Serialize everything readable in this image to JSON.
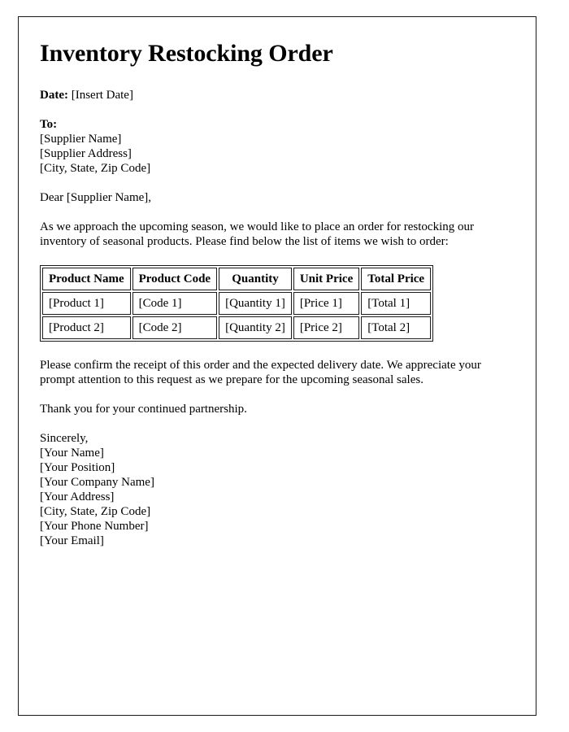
{
  "document": {
    "title": "Inventory Restocking Order",
    "date_label": "Date:",
    "date_value": "[Insert Date]",
    "to_label": "To:",
    "recipient_lines": [
      "[Supplier Name]",
      "[Supplier Address]",
      "[City, State, Zip Code]"
    ],
    "salutation": "Dear [Supplier Name],",
    "intro_paragraph": "As we approach the upcoming season, we would like to place an order for restocking our inventory of seasonal products. Please find below the list of items we wish to order:",
    "confirm_paragraph": "Please confirm the receipt of this order and the expected delivery date. We appreciate your prompt attention to this request as we prepare for the upcoming seasonal sales.",
    "thanks_paragraph": "Thank you for your continued partnership.",
    "closing": "Sincerely,",
    "signature_lines": [
      "[Your Name]",
      "[Your Position]",
      "[Your Company Name]",
      "[Your Address]",
      "[City, State, Zip Code]",
      "[Your Phone Number]",
      "[Your Email]"
    ]
  },
  "items_table": {
    "headers": [
      "Product Name",
      "Product Code",
      "Quantity",
      "Unit Price",
      "Total Price"
    ],
    "rows": [
      [
        "[Product 1]",
        "[Code 1]",
        "[Quantity 1]",
        "[Price 1]",
        "[Total 1]"
      ],
      [
        "[Product 2]",
        "[Code 2]",
        "[Quantity 2]",
        "[Price 2]",
        "[Total 2]"
      ]
    ]
  },
  "colors": {
    "text": "#000000",
    "page_border": "#1a1a1a",
    "table_border": "#1a1a1a",
    "background": "#ffffff"
  }
}
